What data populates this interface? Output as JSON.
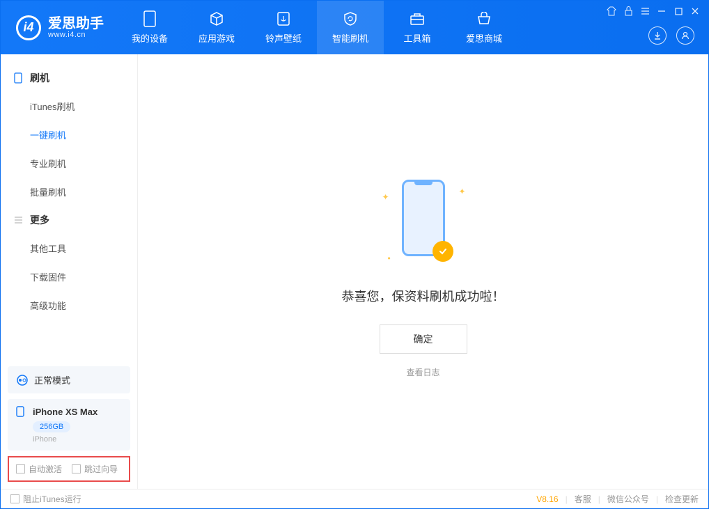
{
  "brand": {
    "name": "爱思助手",
    "url": "www.i4.cn"
  },
  "nav": [
    {
      "label": "我的设备"
    },
    {
      "label": "应用游戏"
    },
    {
      "label": "铃声壁纸"
    },
    {
      "label": "智能刷机"
    },
    {
      "label": "工具箱"
    },
    {
      "label": "爱思商城"
    }
  ],
  "sidebar": {
    "section1": {
      "title": "刷机"
    },
    "items1": [
      {
        "label": "iTunes刷机"
      },
      {
        "label": "一键刷机"
      },
      {
        "label": "专业刷机"
      },
      {
        "label": "批量刷机"
      }
    ],
    "section2": {
      "title": "更多"
    },
    "items2": [
      {
        "label": "其他工具"
      },
      {
        "label": "下载固件"
      },
      {
        "label": "高级功能"
      }
    ]
  },
  "mode": {
    "label": "正常模式"
  },
  "device": {
    "name": "iPhone XS Max",
    "storage": "256GB",
    "type": "iPhone"
  },
  "checkboxes": {
    "auto_activate": "自动激活",
    "skip_guide": "跳过向导"
  },
  "main": {
    "success_text": "恭喜您，保资料刷机成功啦！",
    "ok_button": "确定",
    "log_link": "查看日志"
  },
  "footer": {
    "block_itunes": "阻止iTunes运行",
    "version": "V8.16",
    "support": "客服",
    "wechat": "微信公众号",
    "update": "检查更新"
  }
}
